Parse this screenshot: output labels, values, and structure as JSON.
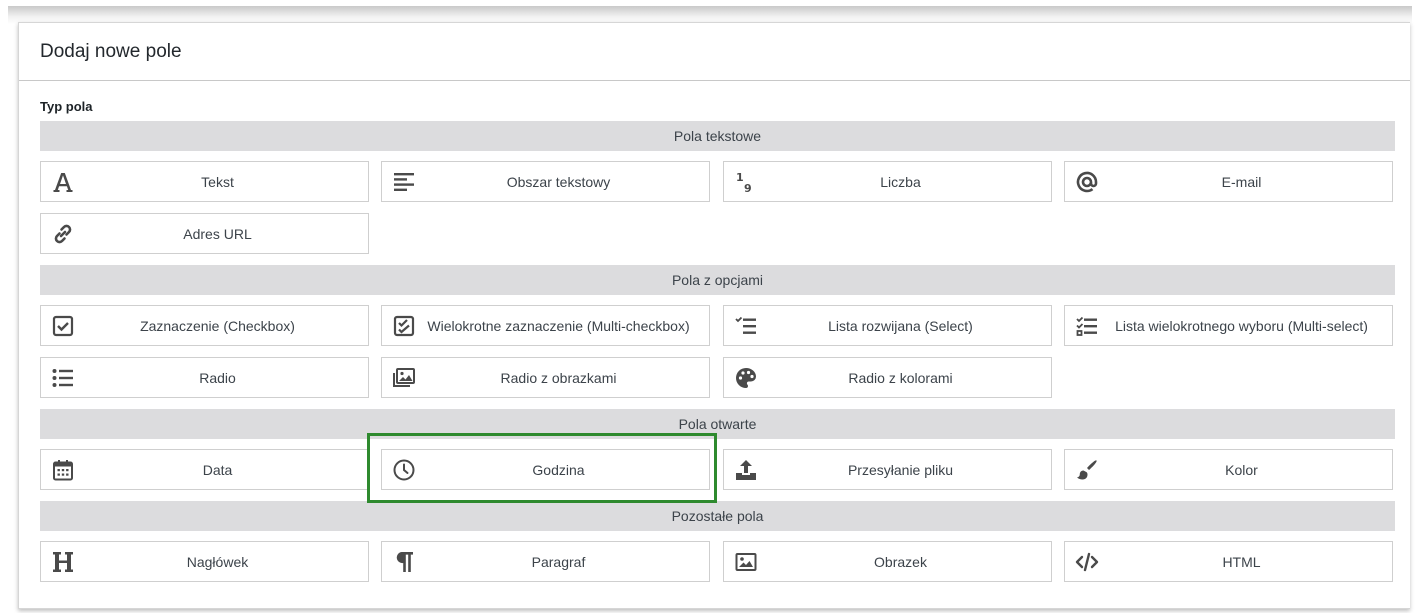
{
  "panel": {
    "title": "Dodaj nowe pole",
    "field_type_label": "Typ pola"
  },
  "colors": {
    "band_bg": "#dcdcde",
    "highlight": "#2e8a2e",
    "icon": "#4a4a4a"
  },
  "groups": [
    {
      "title": "Pola tekstowe",
      "items": [
        {
          "label": "Tekst",
          "icon": "letter-a-icon"
        },
        {
          "label": "Obszar tekstowy",
          "icon": "text-lines-icon"
        },
        {
          "label": "Liczba",
          "icon": "number-icon"
        },
        {
          "label": "E-mail",
          "icon": "at-sign-icon"
        },
        {
          "label": "Adres URL",
          "icon": "link-icon"
        }
      ]
    },
    {
      "title": "Pola z opcjami",
      "items": [
        {
          "label": "Zaznaczenie (Checkbox)",
          "icon": "checkbox-icon"
        },
        {
          "label": "Wielokrotne zaznaczenie (Multi-checkbox)",
          "icon": "multi-checkbox-icon"
        },
        {
          "label": "Lista rozwijana (Select)",
          "icon": "select-list-icon"
        },
        {
          "label": "Lista wielokrotnego wyboru (Multi-select)",
          "icon": "multi-select-icon"
        },
        {
          "label": "Radio",
          "icon": "bullet-list-icon"
        },
        {
          "label": "Radio z obrazkami",
          "icon": "images-icon"
        },
        {
          "label": "Radio z kolorami",
          "icon": "palette-icon"
        }
      ]
    },
    {
      "title": "Pola otwarte",
      "items": [
        {
          "label": "Data",
          "icon": "calendar-icon"
        },
        {
          "label": "Godzina",
          "icon": "clock-icon"
        },
        {
          "label": "Przesyłanie pliku",
          "icon": "upload-icon"
        },
        {
          "label": "Kolor",
          "icon": "paintbrush-icon"
        }
      ]
    },
    {
      "title": "Pozostałe pola",
      "items": [
        {
          "label": "Nagłówek",
          "icon": "heading-icon"
        },
        {
          "label": "Paragraf",
          "icon": "paragraph-icon"
        },
        {
          "label": "Obrazek",
          "icon": "image-icon"
        },
        {
          "label": "HTML",
          "icon": "code-icon"
        }
      ]
    }
  ]
}
